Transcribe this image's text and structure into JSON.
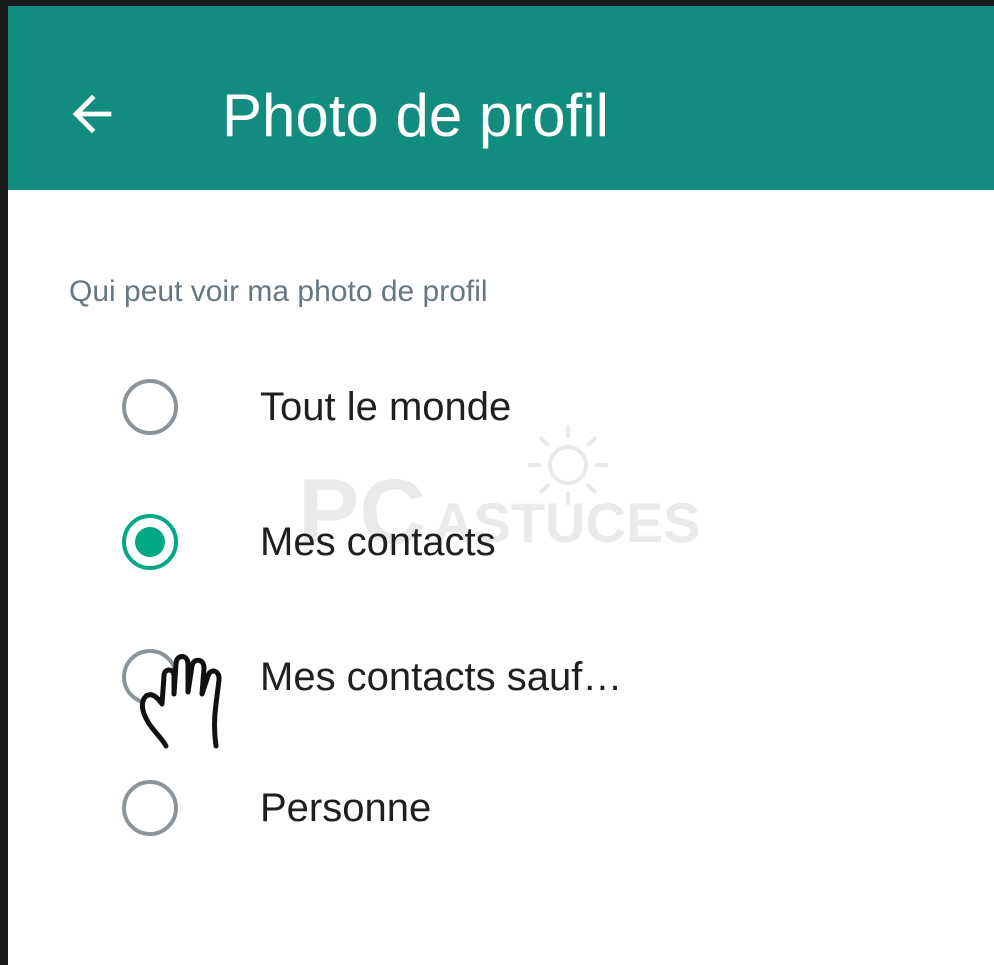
{
  "colors": {
    "appbar": "#128c7e",
    "accent": "#00a884",
    "section_label": "#667781",
    "radio_unchecked": "#8a9499",
    "text": "#1f1f1f"
  },
  "appbar": {
    "back_icon": "arrow-left-icon",
    "title": "Photo de profil"
  },
  "section": {
    "label": "Qui peut voir ma photo de profil"
  },
  "options": [
    {
      "label": "Tout le monde",
      "checked": false
    },
    {
      "label": "Mes contacts",
      "checked": true
    },
    {
      "label": "Mes contacts sauf…",
      "checked": false
    },
    {
      "label": "Personne",
      "checked": false
    }
  ],
  "watermark": {
    "text_pc": "PC",
    "text_astuces": "ASTUCES"
  },
  "cursor": {
    "icon": "hand-pointer-icon"
  }
}
